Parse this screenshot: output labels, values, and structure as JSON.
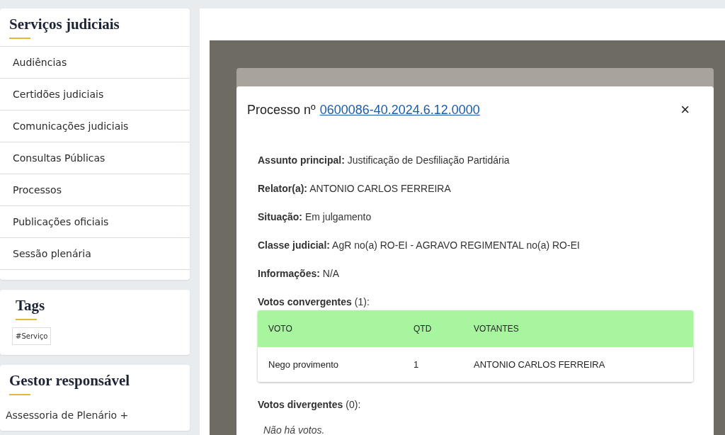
{
  "sidebar": {
    "services": {
      "title": "Serviços judiciais",
      "items": [
        "Audiências",
        "Certidões judiciais",
        "Comunicações judiciais",
        "Consultas Públicas",
        "Processos",
        "Publicações oficiais",
        "Sessão plenária"
      ]
    },
    "tags": {
      "title": "Tags",
      "items": [
        "#Serviço"
      ]
    },
    "manager": {
      "title": "Gestor responsável",
      "text": "Assessoria de Plenário +"
    }
  },
  "modal": {
    "title": "Processo nº",
    "process_link": "0600086-40.2024.6.12.0000",
    "close": "×",
    "fields": [
      {
        "label": "Assunto principal:",
        "value": "Justificação de Desfiliação Partidária"
      },
      {
        "label": "Relator(a):",
        "value": "ANTONIO CARLOS FERREIRA"
      },
      {
        "label": "Situação:",
        "value": "Em julgamento"
      },
      {
        "label": "Classe judicial:",
        "value": "AgR no(a) RO-EI - AGRAVO REGIMENTAL no(a) RO-EI"
      },
      {
        "label": "Informações:",
        "value": "N/A"
      }
    ],
    "convergent": {
      "title": "Votos convergentes",
      "count": "(1):",
      "columns": [
        "VOTO",
        "QTD",
        "VOTANTES"
      ],
      "rows": [
        [
          "Nego provimento",
          "1",
          "ANTONIO CARLOS FERREIRA"
        ]
      ]
    },
    "divergent": {
      "title": "Votos divergentes",
      "count": "(0):",
      "empty": "Não há votos."
    }
  }
}
